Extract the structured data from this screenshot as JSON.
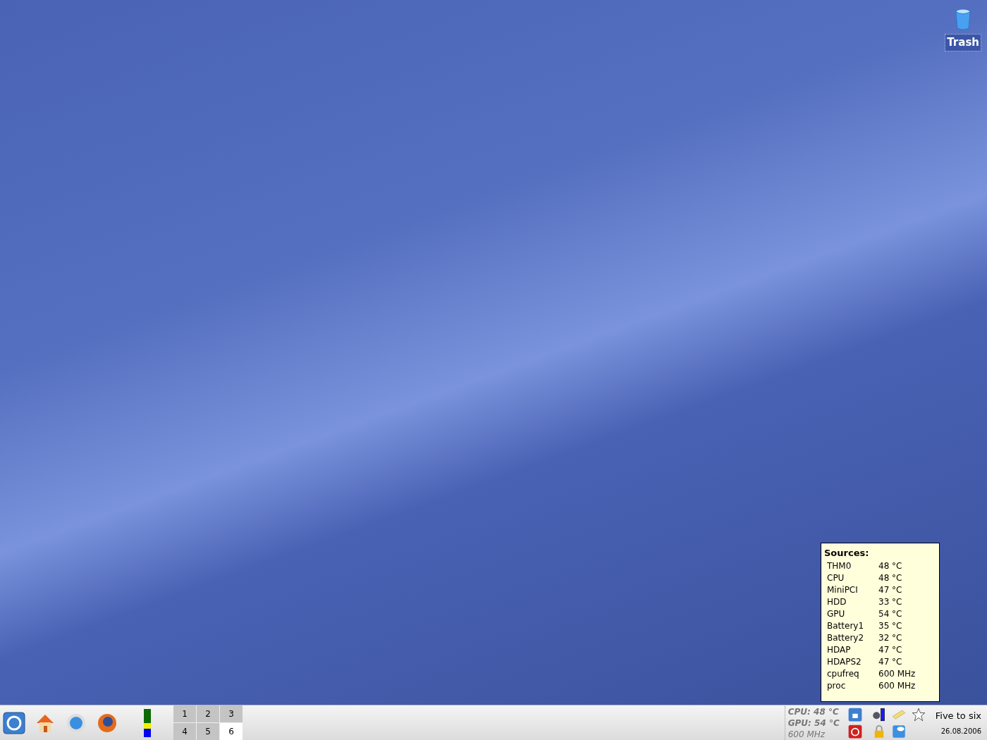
{
  "desktop_icons": [
    {
      "label": "Trash"
    }
  ],
  "tooltip": {
    "title": "Sources:",
    "rows": [
      {
        "name": "THM0",
        "value": "48 °C"
      },
      {
        "name": "CPU",
        "value": "48 °C"
      },
      {
        "name": "MiniPCI",
        "value": "47 °C"
      },
      {
        "name": "HDD",
        "value": "33 °C"
      },
      {
        "name": "GPU",
        "value": "54 °C"
      },
      {
        "name": "Battery1",
        "value": "35 °C"
      },
      {
        "name": "Battery2",
        "value": "32 °C"
      },
      {
        "name": "HDAP",
        "value": "47 °C"
      },
      {
        "name": "HDAPS2",
        "value": "47 °C"
      },
      {
        "name": "cpufreq",
        "value": "600 MHz"
      },
      {
        "name": "proc",
        "value": "600 MHz"
      }
    ]
  },
  "taskbar": {
    "pager": [
      {
        "label": "1",
        "selected": false
      },
      {
        "label": "2",
        "selected": false
      },
      {
        "label": "3",
        "selected": false
      },
      {
        "label": "4",
        "selected": false
      },
      {
        "label": "5",
        "selected": false
      },
      {
        "label": "6",
        "selected": true
      }
    ],
    "sensors": [
      "CPU: 48 °C",
      "GPU: 54 °C",
      "600 MHz"
    ],
    "clock": {
      "time": "Five to six",
      "date": "26.08.2006"
    }
  }
}
